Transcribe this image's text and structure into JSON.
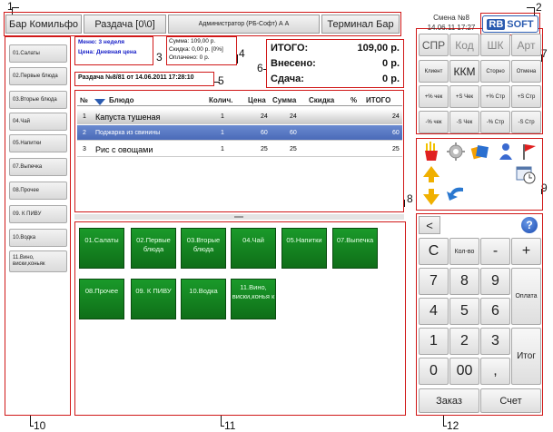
{
  "top_bar": {
    "venue": "Бар Комильфо",
    "station": "Раздача [0\\0]",
    "operator": "Администратор (РБ-Софт) А А",
    "terminal": "Терминал Бар",
    "shift_label": "Смена №8",
    "datetime": "14.06.11 17:27",
    "logo_rb": "RB",
    "logo_soft": "SOFT"
  },
  "menu_info": {
    "menu": "Меню: 3 неделя",
    "price": "Цена: Дневная цена"
  },
  "sum_info": {
    "sum": "Сумма: 109,00 р.",
    "discount": "Скидка: 0,00 р. [0%]",
    "paid": "Оплачено: 0 р."
  },
  "totals": {
    "total_label": "ИТОГО:",
    "total_value": "109,00 р.",
    "deposited_label": "Внесено:",
    "deposited_value": "0 р.",
    "change_label": "Сдача:",
    "change_value": "0 р."
  },
  "order_title": "Раздача №8/81 от 14.06.2011 17:28:10",
  "table": {
    "headers": [
      "№",
      "Блюдо",
      "Колич.",
      "Цена",
      "Сумма",
      "Скидка",
      "%",
      "ИТОГО"
    ],
    "rows": [
      {
        "n": "1",
        "dish": "Капуста тушеная",
        "qty": "1",
        "price": "24",
        "sum": "24",
        "total": "24"
      },
      {
        "n": "2",
        "dish": "Поджарка из свинины",
        "qty": "1",
        "price": "60",
        "sum": "60",
        "total": "60"
      },
      {
        "n": "3",
        "dish": "Рис с овощами",
        "qty": "1",
        "price": "25",
        "sum": "25",
        "total": "25"
      }
    ]
  },
  "categories": [
    "01.Салаты",
    "02.Первые блюда",
    "03.Вторые блюда",
    "04.Чай",
    "05.Напитки",
    "07.Выпечка",
    "08.Прочее",
    "09. К ПИВУ",
    "10.Водка",
    "11.Вино, виски,коньяк"
  ],
  "tiles": [
    "01.Салаты",
    "02.Первые блюда",
    "03.Вторые блюда",
    "04.Чай",
    "05.Напитки",
    "07.Выпечка",
    "08.Прочее",
    "09. К ПИВУ",
    "10.Водка",
    "11.Вино, виски,конья к"
  ],
  "mode_buttons": [
    "СПР",
    "Код",
    "ШК",
    "Арт"
  ],
  "func_buttons": [
    "Клиент",
    "ККМ",
    "Сторно",
    "Отмена",
    "+% чек",
    "+S Чек",
    "+% Стр",
    "+S Стр",
    "-% чек",
    "-S Чек",
    "-% Стр",
    "-S Стр"
  ],
  "keypad": {
    "back": "<",
    "help": "?",
    "c": "C",
    "qty": "Кол-во",
    "minus": "-",
    "plus": "+",
    "d7": "7",
    "d8": "8",
    "d9": "9",
    "d4": "4",
    "d5": "5",
    "d6": "6",
    "d1": "1",
    "d2": "2",
    "d3": "3",
    "d0": "0",
    "d00": "00",
    "comma": ",",
    "pay": "Оплата",
    "itog": "Итог",
    "order": "Заказ",
    "bill": "Счет"
  },
  "callouts": [
    "1",
    "2",
    "3",
    "4",
    "5",
    "6",
    "7",
    "8",
    "9",
    "10",
    "11",
    "12"
  ],
  "colors": {
    "callout_box": "#d01818",
    "selected_row": "#4a6ab8",
    "tile_green": "#1a9a2a",
    "menu_text": "#1a22c8"
  }
}
